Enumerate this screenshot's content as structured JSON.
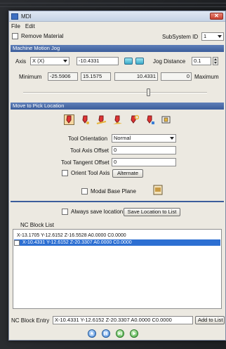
{
  "window": {
    "title": "MDI",
    "close_glyph": "✕",
    "menu": [
      "File",
      "Edit"
    ]
  },
  "top": {
    "remove_material_label": "Remove Material",
    "subsystem_label": "SubSystem ID",
    "subsystem_value": "1"
  },
  "machine_motion": {
    "header": "Machine Motion Jog",
    "axis_label": "Axis",
    "axis_value": "X (X)",
    "axis_position": "-10.4331",
    "jog_distance_label": "Jog Distance",
    "jog_distance_value": "0.1",
    "minimum_label": "Minimum",
    "min_value": "-25.5906",
    "range_value": "15.1575",
    "current_value": "10.4331",
    "zero_value": "0",
    "maximum_label": "Maximum",
    "slider_fraction": 0.68
  },
  "pick_location": {
    "header": "Move to Pick Location",
    "tool_icons": [
      "tool-pick-icon",
      "tool-point-icon",
      "tool-line-icon",
      "tool-surface-icon",
      "tool-rotate-icon",
      "tool-normal-icon",
      "tool-view-icon"
    ],
    "tool_orientation_label": "Tool Orientation",
    "tool_orientation_value": "Normal",
    "tool_axis_offset_label": "Tool Axis Offset",
    "tool_axis_offset_value": "0",
    "tool_tangent_offset_label": "Tool Tangent Offset",
    "tool_tangent_offset_value": "0",
    "orient_tool_axis_label": "Orient Tool Axis",
    "alternate_label": "Alternate",
    "modal_base_plane_label": "Modal Base Plane"
  },
  "save_location": {
    "always_save_label": "Always save location",
    "save_button_label": "Save Location to List"
  },
  "nc_block_list": {
    "header": "NC Block List",
    "rows": [
      "X-13.1705 Y-12.6152 Z-16.5528 A0.0000 C0.0000",
      "X-10.4331 Y-12.6152 Z-20.3307 A0.0000 C0.0000"
    ],
    "selected_index": 1
  },
  "entry": {
    "label": "NC Block Entry",
    "value": "X-10.4331 Y-12.6152 Z-20.3307 A0.0000 C0.0000",
    "add_button_label": "Add to List"
  },
  "colors": {
    "header_bg": "#3b5d9b",
    "selection_bg": "#2d6fd2"
  }
}
